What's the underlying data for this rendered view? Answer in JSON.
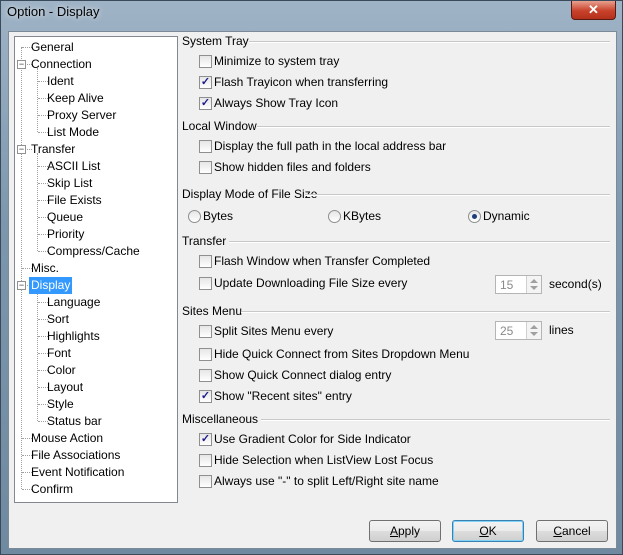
{
  "window": {
    "title": "Option - Display",
    "close_glyph": "✕"
  },
  "tree": {
    "items": [
      {
        "label": "General",
        "level": 0
      },
      {
        "label": "Connection",
        "level": 0,
        "expander": "−"
      },
      {
        "label": "Ident",
        "level": 1
      },
      {
        "label": "Keep Alive",
        "level": 1
      },
      {
        "label": "Proxy Server",
        "level": 1
      },
      {
        "label": "List Mode",
        "level": 1
      },
      {
        "label": "Transfer",
        "level": 0,
        "expander": "−"
      },
      {
        "label": "ASCII List",
        "level": 1
      },
      {
        "label": "Skip List",
        "level": 1
      },
      {
        "label": "File Exists",
        "level": 1
      },
      {
        "label": "Queue",
        "level": 1
      },
      {
        "label": "Priority",
        "level": 1
      },
      {
        "label": "Compress/Cache",
        "level": 1
      },
      {
        "label": "Misc.",
        "level": 0
      },
      {
        "label": "Display",
        "level": 0,
        "expander": "−",
        "selected": true
      },
      {
        "label": "Language",
        "level": 1
      },
      {
        "label": "Sort",
        "level": 1
      },
      {
        "label": "Highlights",
        "level": 1
      },
      {
        "label": "Font",
        "level": 1
      },
      {
        "label": "Color",
        "level": 1
      },
      {
        "label": "Layout",
        "level": 1
      },
      {
        "label": "Style",
        "level": 1
      },
      {
        "label": "Status bar",
        "level": 1
      },
      {
        "label": "Mouse Action",
        "level": 0
      },
      {
        "label": "File Associations",
        "level": 0
      },
      {
        "label": "Event Notification",
        "level": 0
      },
      {
        "label": "Confirm",
        "level": 0
      }
    ]
  },
  "system_tray": {
    "title": "System Tray",
    "minimize": {
      "label": "Minimize to system tray",
      "checked": false
    },
    "flash": {
      "label": "Flash Trayicon when transferring",
      "checked": true
    },
    "always": {
      "label": "Always Show Tray Icon",
      "checked": true
    }
  },
  "local_window": {
    "title": "Local Window",
    "full_path": {
      "label": "Display the full path in the local address bar",
      "checked": false
    },
    "hidden": {
      "label": "Show hidden files and folders",
      "checked": false
    }
  },
  "file_size": {
    "title": "Display Mode of File Size",
    "bytes": {
      "label": "Bytes",
      "selected": false
    },
    "kbytes": {
      "label": "KBytes",
      "selected": false
    },
    "dynamic": {
      "label": "Dynamic",
      "selected": true
    }
  },
  "transfer": {
    "title": "Transfer",
    "flash_window": {
      "label": "Flash Window when Transfer Completed",
      "checked": false
    },
    "update_size": {
      "label": "Update Downloading File Size every",
      "checked": false
    },
    "update_value": "15",
    "update_unit": "second(s)"
  },
  "sites_menu": {
    "title": "Sites Menu",
    "split": {
      "label": "Split Sites Menu every",
      "checked": false
    },
    "split_value": "25",
    "split_unit": "lines",
    "hide_qc": {
      "label": "Hide Quick Connect from Sites Dropdown Menu",
      "checked": false
    },
    "show_qc": {
      "label": "Show Quick Connect dialog entry",
      "checked": false
    },
    "recent": {
      "label": "Show \"Recent sites\" entry",
      "checked": true
    }
  },
  "misc": {
    "title": "Miscellaneous",
    "gradient": {
      "label": "Use Gradient Color for Side Indicator",
      "checked": true
    },
    "hide_sel": {
      "label": "Hide Selection when ListView Lost Focus",
      "checked": false
    },
    "dash": {
      "label": "Always use \"-\" to split Left/Right site name",
      "checked": false
    }
  },
  "buttons": {
    "apply": {
      "label": "Apply",
      "u": "A",
      "rest": "pply"
    },
    "ok": {
      "label": "OK",
      "u": "O",
      "rest": "K"
    },
    "cancel": {
      "label": "Cancel",
      "u": "C",
      "rest": "ancel"
    }
  },
  "check_glyph": "✓"
}
